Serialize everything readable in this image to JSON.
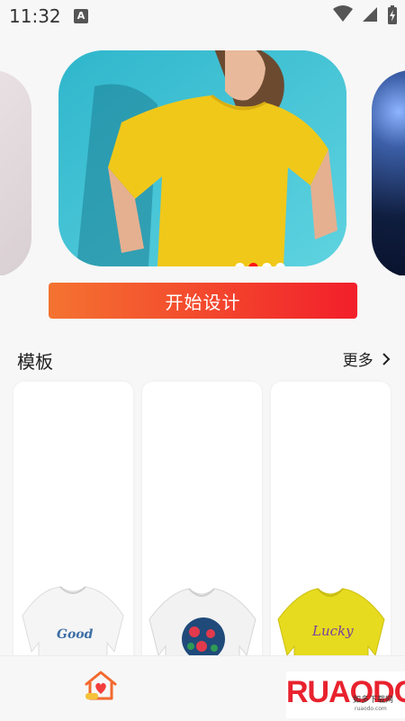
{
  "status_bar": {
    "time": "11:32",
    "notification_icon": "A"
  },
  "carousel": {
    "slides": 4,
    "active_index": 1
  },
  "start_button": {
    "label": "开始设计"
  },
  "templates_section": {
    "title": "模板",
    "more_label": "更多",
    "cards": [
      {
        "shirt_color": "#f5f5f5",
        "print_text": "Good"
      },
      {
        "shirt_color": "#f2f2f2",
        "print_text": ""
      },
      {
        "shirt_color": "#e6db1e",
        "print_text": "Lucky"
      }
    ]
  },
  "watermark": {
    "main": "RUAODO",
    "sub": "如多下载网",
    "url": "ruaodo.com"
  },
  "colors": {
    "accent_start": "#f47331",
    "accent_end": "#f21f2a",
    "background": "#f7f7f7"
  }
}
